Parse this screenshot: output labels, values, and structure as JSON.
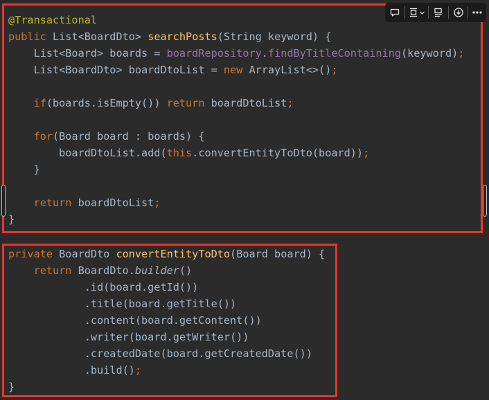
{
  "colors": {
    "background": "#2b2b2b",
    "highlight_border": "#e8372a",
    "keyword": "#cc7832",
    "annotation": "#bbb529",
    "method_declaration": "#ffc66d",
    "field": "#9876aa",
    "plain": "#a9b7c6"
  },
  "toolbar": {
    "icons": [
      "comment-icon",
      "screenshot-icon",
      "chevron-down-icon",
      "layout-icon",
      "download-icon",
      "more-icon"
    ]
  },
  "code_block_1": {
    "lines": [
      [
        {
          "t": "@Transactional",
          "c": "annotation"
        }
      ],
      [
        {
          "t": "public",
          "c": "keyword"
        },
        {
          "t": " List<BoardDto> ",
          "c": "plain"
        },
        {
          "t": "searchPosts",
          "c": "method_declaration"
        },
        {
          "t": "(String keyword) {",
          "c": "plain"
        }
      ],
      [
        {
          "t": "    List<Board> boards = ",
          "c": "plain"
        },
        {
          "t": "boardRepository",
          "c": "field"
        },
        {
          "t": ".",
          "c": "plain"
        },
        {
          "t": "findByTitleContaining",
          "c": "field"
        },
        {
          "t": "(keyword)",
          "c": "plain"
        },
        {
          "t": ";",
          "c": "keyword"
        }
      ],
      [
        {
          "t": "    List<BoardDto> boardDtoList = ",
          "c": "plain"
        },
        {
          "t": "new",
          "c": "keyword"
        },
        {
          "t": " ArrayList<>()",
          "c": "plain"
        },
        {
          "t": ";",
          "c": "keyword"
        }
      ],
      [],
      [
        {
          "t": "    ",
          "c": "plain"
        },
        {
          "t": "if",
          "c": "keyword"
        },
        {
          "t": "(boards.isEmpty()) ",
          "c": "plain"
        },
        {
          "t": "return",
          "c": "keyword"
        },
        {
          "t": " boardDtoList",
          "c": "plain"
        },
        {
          "t": ";",
          "c": "keyword"
        }
      ],
      [],
      [
        {
          "t": "    ",
          "c": "plain"
        },
        {
          "t": "for",
          "c": "keyword"
        },
        {
          "t": "(Board board : boards) {",
          "c": "plain"
        }
      ],
      [
        {
          "t": "        boardDtoList.add(",
          "c": "plain"
        },
        {
          "t": "this",
          "c": "keyword"
        },
        {
          "t": ".convertEntityToDto(board))",
          "c": "plain"
        },
        {
          "t": ";",
          "c": "keyword"
        }
      ],
      [
        {
          "t": "    }",
          "c": "plain"
        }
      ],
      [],
      [
        {
          "t": "    ",
          "c": "plain"
        },
        {
          "t": "return",
          "c": "keyword"
        },
        {
          "t": " boardDtoList",
          "c": "plain"
        },
        {
          "t": ";",
          "c": "keyword"
        }
      ],
      [
        {
          "t": "}",
          "c": "plain"
        }
      ]
    ]
  },
  "code_block_2": {
    "lines": [
      [
        {
          "t": "private",
          "c": "keyword"
        },
        {
          "t": " BoardDto ",
          "c": "plain"
        },
        {
          "t": "convertEntityToDto",
          "c": "method_declaration"
        },
        {
          "t": "(Board board) {",
          "c": "plain"
        }
      ],
      [
        {
          "t": "    ",
          "c": "plain"
        },
        {
          "t": "return",
          "c": "keyword"
        },
        {
          "t": " BoardDto.",
          "c": "plain"
        },
        {
          "t": "builder",
          "c": "plain",
          "italic": true
        },
        {
          "t": "()",
          "c": "plain"
        }
      ],
      [
        {
          "t": "            .id(board.getId())",
          "c": "plain"
        }
      ],
      [
        {
          "t": "            .title(board.getTitle())",
          "c": "plain"
        }
      ],
      [
        {
          "t": "            .content(board.getContent())",
          "c": "plain"
        }
      ],
      [
        {
          "t": "            .writer(board.getWriter())",
          "c": "plain"
        }
      ],
      [
        {
          "t": "            .createdDate(board.getCreatedDate())",
          "c": "plain"
        }
      ],
      [
        {
          "t": "            .build()",
          "c": "plain"
        },
        {
          "t": ";",
          "c": "keyword"
        }
      ],
      [
        {
          "t": "}",
          "c": "plain"
        }
      ]
    ]
  }
}
